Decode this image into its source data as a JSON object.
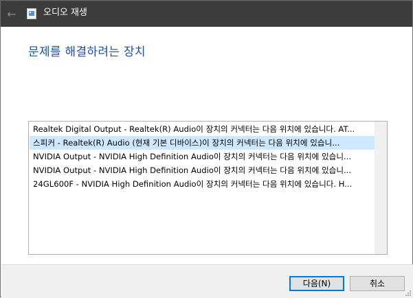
{
  "window": {
    "title": "오디오 재생",
    "back_glyph": "←"
  },
  "heading": "문제를 해결하려는 장치",
  "devices": [
    {
      "label": "Realtek Digital Output - Realtek(R) Audio이 장치의 커넥터는 다음 위치에 있습니다. AT..."
    },
    {
      "label": "스피커 - Realtek(R) Audio (현재 기본 디바이스)이 장치의 커넥터는 다음 위치에 있습니..."
    },
    {
      "label": "NVIDIA Output - NVIDIA High Definition Audio이 장치의 커넥터는 다음 위치에 있습니..."
    },
    {
      "label": "NVIDIA Output - NVIDIA High Definition Audio이 장치의 커넥터는 다음 위치에 있습니..."
    },
    {
      "label": "24GL600F - NVIDIA High Definition Audio이 장치의 커넥터는 다음 위치에 있습니다. H..."
    }
  ],
  "selected_index": 1,
  "buttons": {
    "next": "다음(N)",
    "cancel": "취소"
  },
  "colors": {
    "titlebar": "#3c3c3c",
    "heading": "#1f4fa0",
    "selection": "#cde8ff",
    "default_button_border": "#0078d7"
  }
}
